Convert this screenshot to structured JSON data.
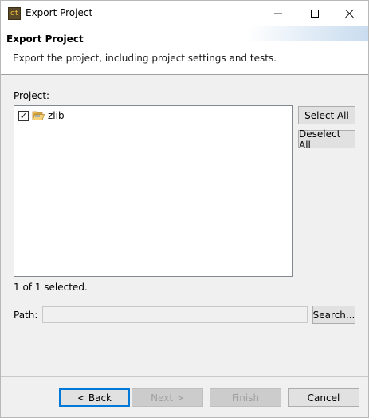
{
  "window": {
    "title": "Export Project",
    "app_icon_text": "ct"
  },
  "header": {
    "title": "Export Project",
    "description": "Export the project, including project settings and tests."
  },
  "project_section": {
    "label": "Project:",
    "items": [
      {
        "name": "zlib",
        "checked": true,
        "icon": "folder-open-icon"
      }
    ],
    "status": "1 of 1 selected.",
    "select_all_label": "Select All",
    "deselect_all_label": "Deselect All"
  },
  "path_section": {
    "label": "Path:",
    "value": "",
    "browse_label": "Search..."
  },
  "footer": {
    "back_label": "< Back",
    "next_label": "Next >",
    "finish_label": "Finish",
    "cancel_label": "Cancel"
  }
}
